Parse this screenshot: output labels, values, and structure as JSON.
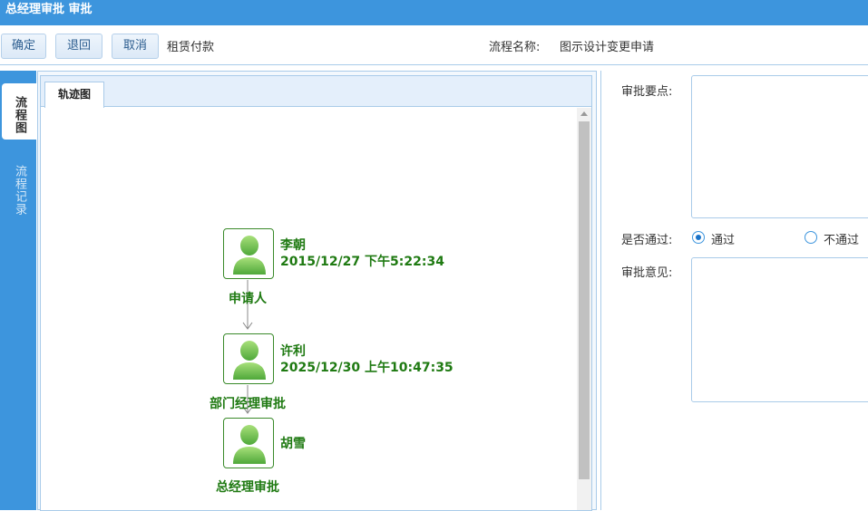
{
  "window": {
    "title": "总经理审批 审批"
  },
  "toolbar": {
    "confirm_label": "确定",
    "back_label": "退回",
    "cancel_label": "取消",
    "doc_type": "租赁付款",
    "process_name_label": "流程名称:",
    "process_name": "图示设计变更申请"
  },
  "side_tabs": {
    "flowchart": "流程图",
    "records": "流程记录"
  },
  "flow": {
    "tab_label": "轨迹图",
    "nodes": [
      {
        "name": "李朝",
        "time": "2015/12/27 下午5:22:34",
        "role": "申请人"
      },
      {
        "name": "许利",
        "time": "2025/12/30 上午10:47:35",
        "role": "部门经理审批"
      },
      {
        "name": "胡雪",
        "time": "",
        "role": "总经理审批"
      }
    ]
  },
  "form": {
    "key_points_label": "审批要点:",
    "pass_label": "是否通过:",
    "pass_option": "通过",
    "fail_option": "不通过",
    "selected": "通过",
    "opinion_label": "审批意见:",
    "key_points_value": "",
    "opinion_value": ""
  },
  "colors": {
    "accent": "#3d95dd",
    "node_green": "#1f7a12"
  },
  "icons": {
    "user": "user-avatar-icon",
    "arrow": "arrow-down-icon"
  }
}
